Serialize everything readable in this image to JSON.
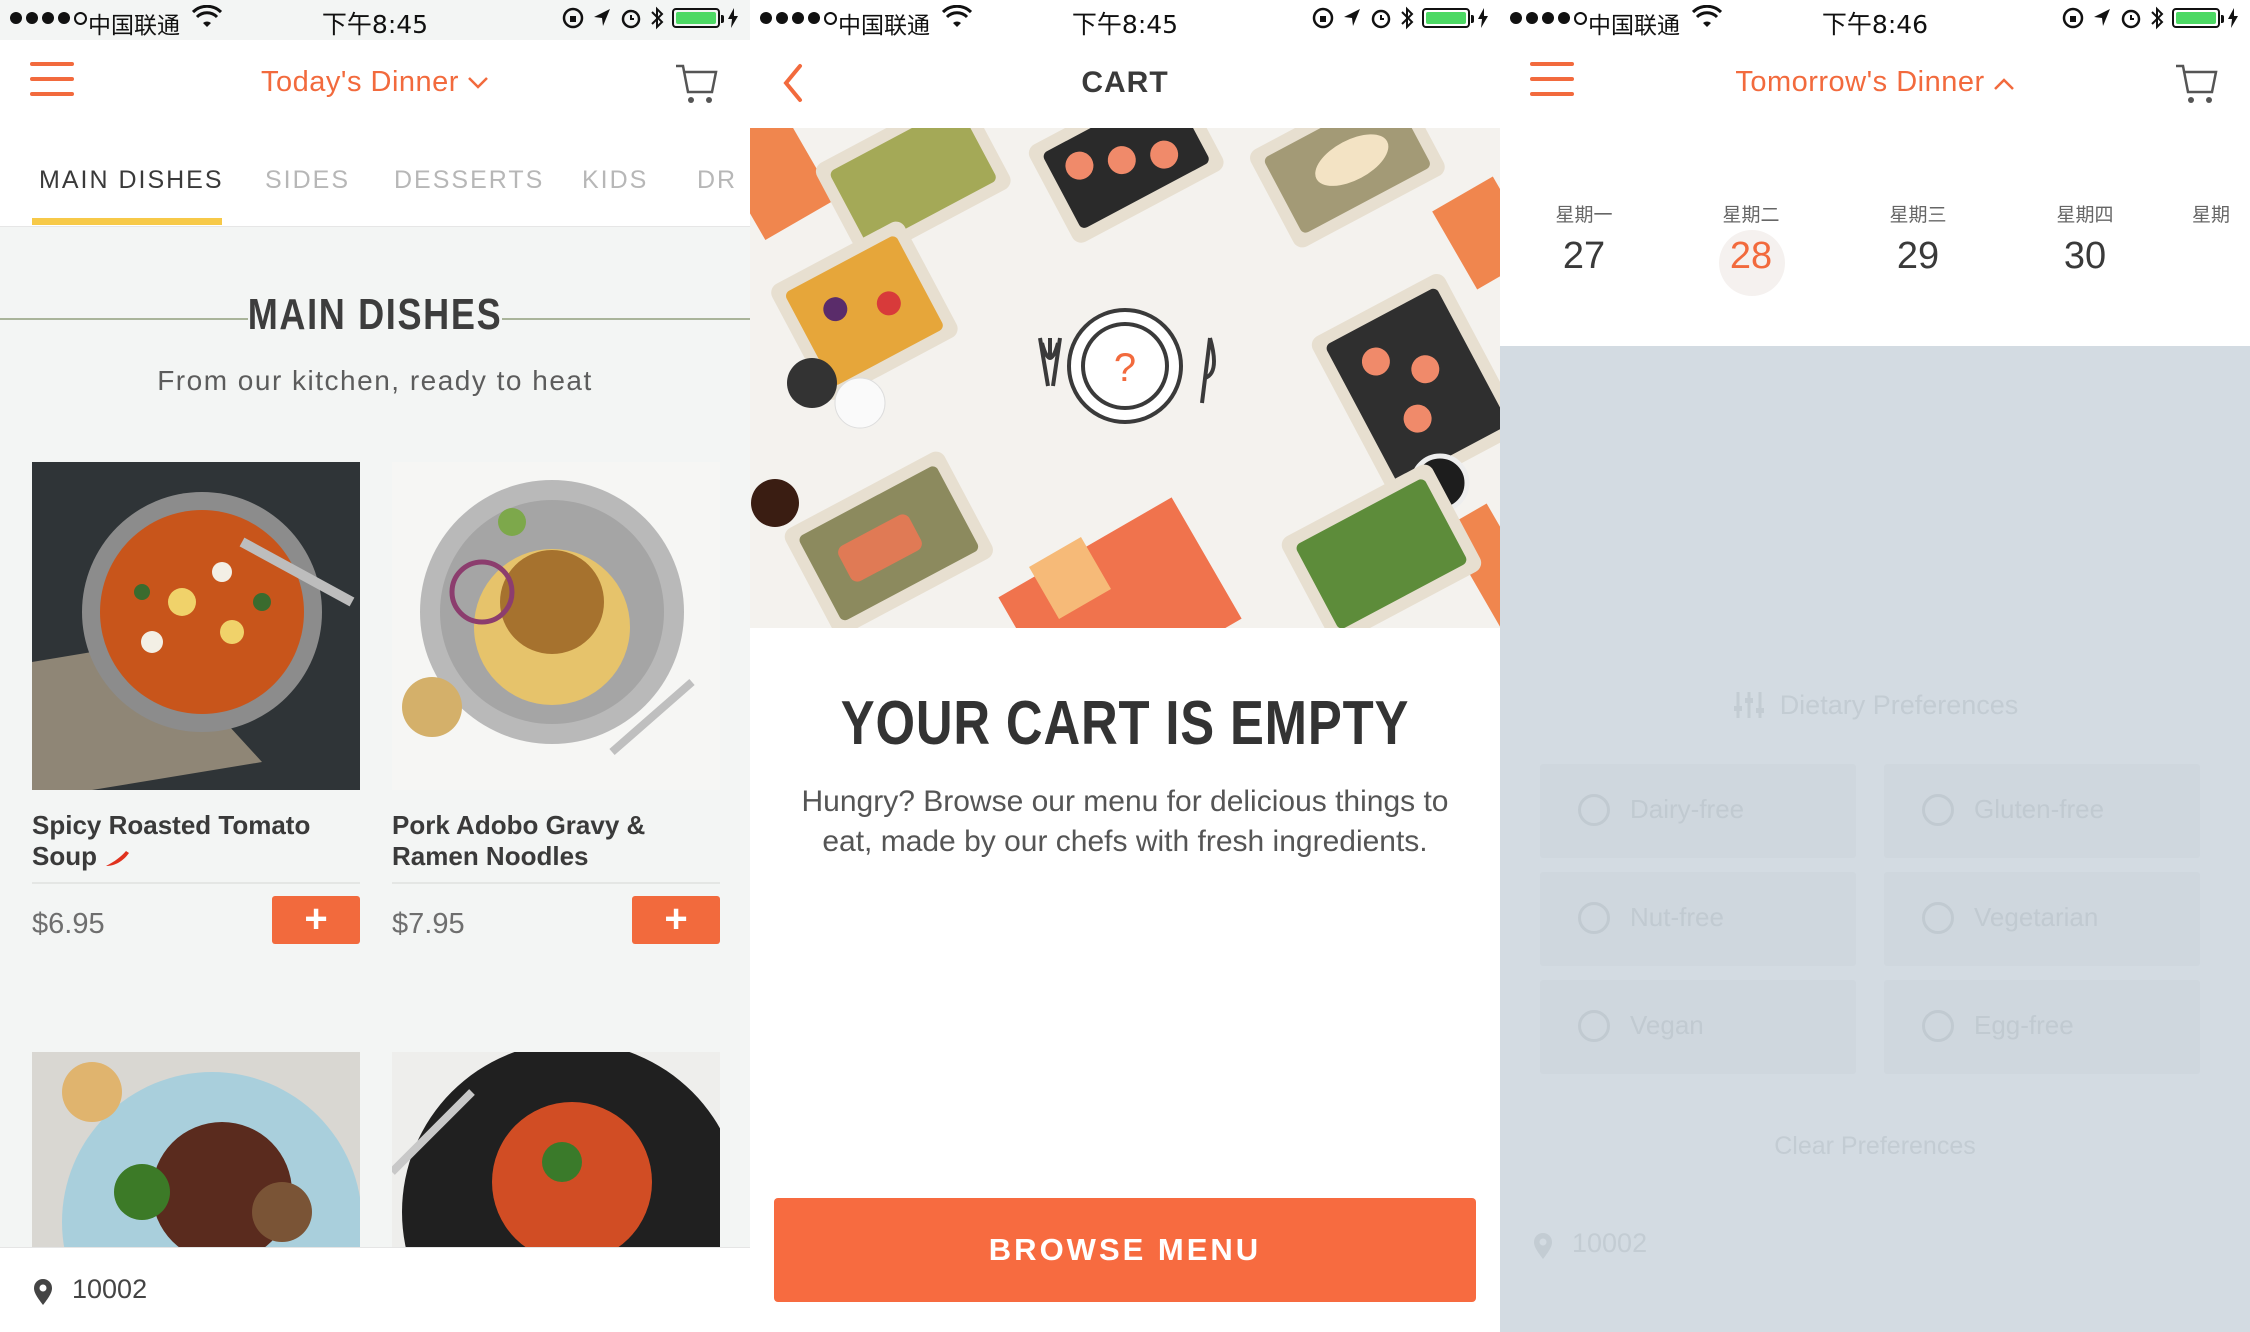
{
  "panels": [
    {
      "status": {
        "carrier": "中国联通",
        "time": "下午8:45"
      },
      "nav": {
        "title": "Today's Dinner",
        "chevron": "⌄"
      },
      "tabs": [
        "MAIN DISHES",
        "SIDES",
        "DESSERTS",
        "KIDS",
        "DR"
      ],
      "section": {
        "title": "MAIN DISHES",
        "subtitle": "From our kitchen, ready to heat"
      },
      "cards": [
        {
          "name": "Spicy Roasted Tomato Soup",
          "spicy_icon": "chili-pepper-icon",
          "price": "$6.95",
          "add": "+"
        },
        {
          "name": "Pork Adobo Gravy & Ramen Noodles",
          "price": "$7.95",
          "add": "+"
        }
      ],
      "zip": "10002"
    },
    {
      "status": {
        "carrier": "中国联通",
        "time": "下午8:45"
      },
      "nav": {
        "title": "CART"
      },
      "empty": {
        "title": "YOUR CART IS EMPTY",
        "text": "Hungry? Browse our menu for delicious things to eat, made by our chefs with fresh ingredients.",
        "hero_mark": "?"
      },
      "button": "BROWSE MENU"
    },
    {
      "status": {
        "carrier": "中国联通",
        "time": "下午8:46"
      },
      "nav": {
        "title": "Tomorrow's Dinner",
        "chevron": "⌃"
      },
      "days": [
        {
          "name": "星期一",
          "num": "27",
          "selected": false
        },
        {
          "name": "星期二",
          "num": "28",
          "selected": true
        },
        {
          "name": "星期三",
          "num": "29",
          "selected": false
        },
        {
          "name": "星期四",
          "num": "30",
          "selected": false
        },
        {
          "name": "星期",
          "num": "",
          "selected": false
        }
      ],
      "prefs": {
        "title": "Dietary Preferences",
        "options": [
          "Dairy-free",
          "Gluten-free",
          "Nut-free",
          "Vegetarian",
          "Vegan",
          "Egg-free"
        ],
        "clear": "Clear Preferences"
      },
      "zip": "10002"
    }
  ],
  "colors": {
    "accent": "#f26a3d",
    "highlight": "#f7c948",
    "overlay": "#d3dbe2"
  }
}
